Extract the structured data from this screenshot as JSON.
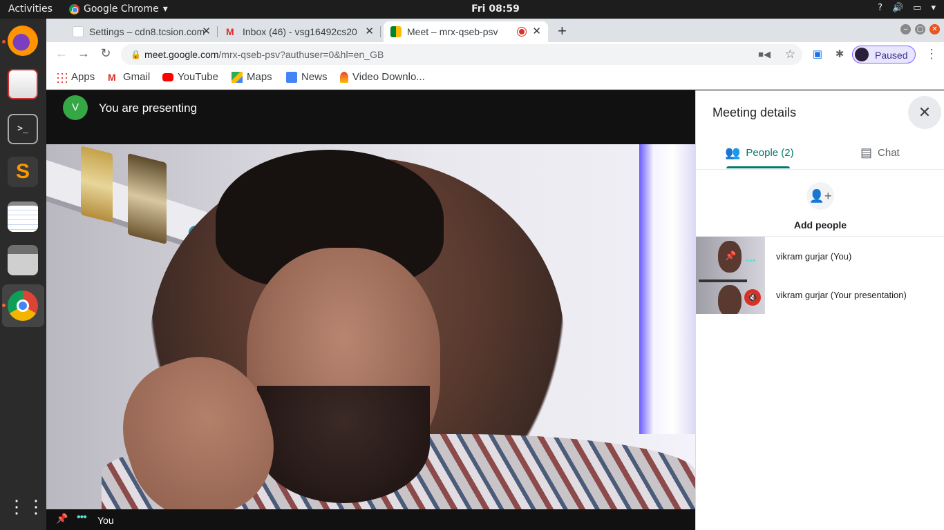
{
  "topbar": {
    "activities": "Activities",
    "app_name": "Google Chrome",
    "clock": "Fri 08:59",
    "tray_help": "?",
    "tray_volume": "🔊",
    "tray_menu": "▾"
  },
  "dock": {
    "apps": [
      "firefox",
      "libreoffice-impress",
      "terminal",
      "sublime-text",
      "text-editor",
      "file-manager",
      "google-chrome",
      "show-applications"
    ]
  },
  "browser": {
    "tabs": [
      {
        "label": "Settings – cdn8.tcsion.com",
        "active": false
      },
      {
        "label": "Inbox (46) - vsg16492cs20",
        "active": false
      },
      {
        "label": "Meet – mrx-qseb-psv",
        "active": true
      }
    ],
    "tab_close": "✕",
    "new_tab": "+",
    "url_host": "meet.google.com",
    "url_path": "/mrx-qseb-psv?authuser=0&hl=en_GB",
    "profile_status": "Paused",
    "bookmarks": [
      {
        "label": "Apps",
        "icon": "apps-grid-icon"
      },
      {
        "label": "Gmail",
        "icon": "gmail-icon"
      },
      {
        "label": "YouTube",
        "icon": "youtube-icon"
      },
      {
        "label": "Maps",
        "icon": "maps-icon"
      },
      {
        "label": "News",
        "icon": "news-icon"
      },
      {
        "label": "Video Downlo...",
        "icon": "video-downloader-icon"
      }
    ]
  },
  "meet": {
    "presenter_initial": "V",
    "presenting_text": "You are presenting",
    "self_label": "You",
    "panel": {
      "title": "Meeting details",
      "tabs": [
        {
          "label": "People (2)",
          "active": true
        },
        {
          "label": "Chat",
          "active": false
        }
      ],
      "add_people": "Add people",
      "participants": [
        {
          "name": "vikram gurjar (You)",
          "muted": false
        },
        {
          "name": "vikram gurjar (Your presentation)",
          "muted": true
        }
      ]
    }
  },
  "colors": {
    "meet_accent": "#00796b",
    "avatar_green": "#35a845",
    "muted_red": "#d93025",
    "ubuntu_orange": "#e95420"
  }
}
